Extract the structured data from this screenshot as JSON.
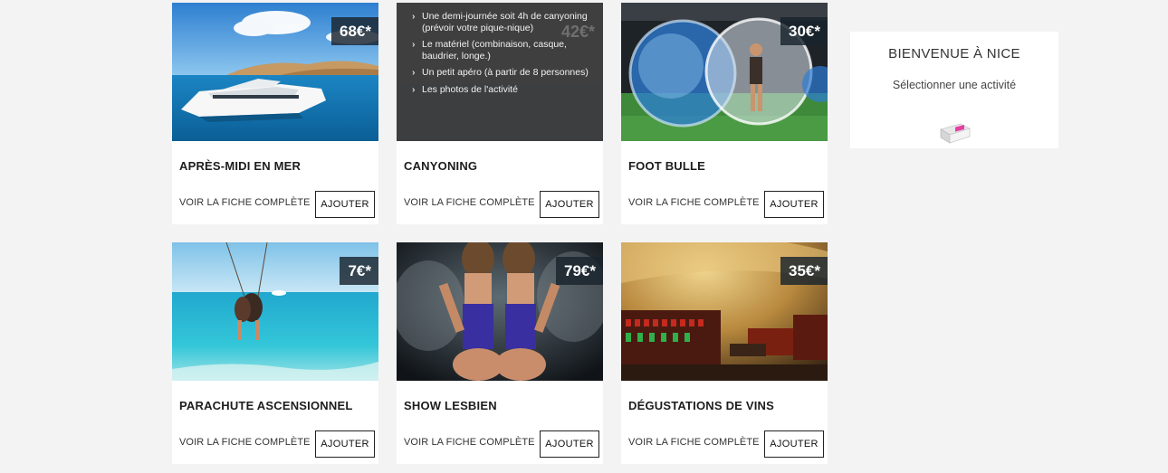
{
  "cards": [
    {
      "title": "APRÈS-MIDI EN MER",
      "link": "VOIR LA FICHE COMPLÈTE",
      "button": "AJOUTER",
      "price": "68€*",
      "image": "yacht-photo"
    },
    {
      "title": "CANYONING",
      "link": "VOIR LA FICHE COMPLÈTE",
      "button": "AJOUTER",
      "price": "42€*",
      "image": "canyoning-photo",
      "overlay_items": [
        "Une demi-journée soit 4h de canyoning (prévoir votre pique-nique)",
        "Le matériel (combinaison, casque, baudrier, longe.)",
        "Un petit apéro (à partir de 8 personnes)",
        "Les photos de l'activité"
      ]
    },
    {
      "title": "FOOT BULLE",
      "link": "VOIR LA FICHE COMPLÈTE",
      "button": "AJOUTER",
      "price": "30€*",
      "image": "bubble-football-photo"
    },
    {
      "title": "PARACHUTE ASCENSIONNEL",
      "link": "VOIR LA FICHE COMPLÈTE",
      "button": "AJOUTER",
      "price": "7€*",
      "image": "parasailing-photo"
    },
    {
      "title": "SHOW LESBIEN",
      "link": "VOIR LA FICHE COMPLÈTE",
      "button": "AJOUTER",
      "price": "79€*",
      "image": "show-photo"
    },
    {
      "title": "DÉGUSTATIONS DE VINS",
      "link": "VOIR LA FICHE COMPLÈTE",
      "button": "AJOUTER",
      "price": "35€*",
      "image": "wine-cellar-photo"
    }
  ],
  "welcome": {
    "title": "BIENVENUE À NICE",
    "subtitle": "Sélectionner une activité",
    "icon": "cart-box-icon"
  },
  "colors": {
    "background": "#f3f3f3",
    "card": "#ffffff",
    "price_badge": "#19232d",
    "button_border": "#222222"
  }
}
